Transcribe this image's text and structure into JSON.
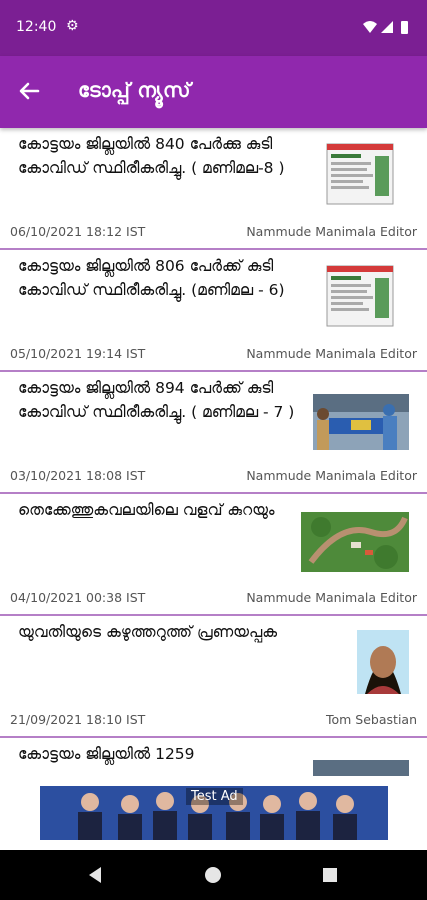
{
  "status_bar": {
    "time": "12:40",
    "settings_icon": "gear-icon"
  },
  "app_bar": {
    "title": "ടോപ്പ് ന്യൂസ്",
    "back_icon": "arrow-back-icon"
  },
  "articles": [
    {
      "title": "കോട്ടയം ജില്ലയിൽ 840 പേർക്കു കുടി കോവിഡ് സ്ഥിരീകരിച്ചു. ( മണിമല-8 )",
      "date": "06/10/2021 18:12 IST",
      "author": "Nammude Manimala Editor",
      "thumbnail": "covid-stats-thumbnail"
    },
    {
      "title": "കോട്ടയം ജില്ലയിൽ 806 പേർക്ക് കുടി കോവിഡ് സ്ഥിരീകരിച്ചു. (മണിമല - 6)",
      "date": "05/10/2021 19:14 IST",
      "author": "Nammude Manimala Editor",
      "thumbnail": "covid-stats-thumbnail"
    },
    {
      "title": "കോട്ടയം ജില്ലയിൽ 894 പേർക്ക് കുടി കോവിഡ് സ്ഥിരീകരിച്ചു. ( മണിമല - 7 )",
      "date": "03/10/2021 18:08 IST",
      "author": "Nammude Manimala Editor",
      "thumbnail": "health-workers-photo"
    },
    {
      "title": "തെക്കേത്തുകവലയിലെ വളവ് കുറയും",
      "date": "04/10/2021 00:38 IST",
      "author": "Nammude Manimala Editor",
      "thumbnail": "aerial-road-photo"
    },
    {
      "title": "യുവതിയുടെ കഴുത്തറുത്ത് പ്രണയപ്പക",
      "date": "21/09/2021 18:10 IST",
      "author": "Tom Sebastian",
      "thumbnail": "woman-portrait-photo"
    },
    {
      "title": "കോട്ടയം ജില്ലയിൽ 1259",
      "date": "",
      "author": "",
      "thumbnail": "health-workers-photo"
    }
  ],
  "ad": {
    "label": "Test Ad"
  },
  "nav_bar": {
    "back": "nav-back-icon",
    "home": "nav-home-icon",
    "recents": "nav-recents-icon"
  },
  "colors": {
    "status_bar": "#7b1f93",
    "app_bar": "#9028ad",
    "divider": "#b57fc7"
  }
}
